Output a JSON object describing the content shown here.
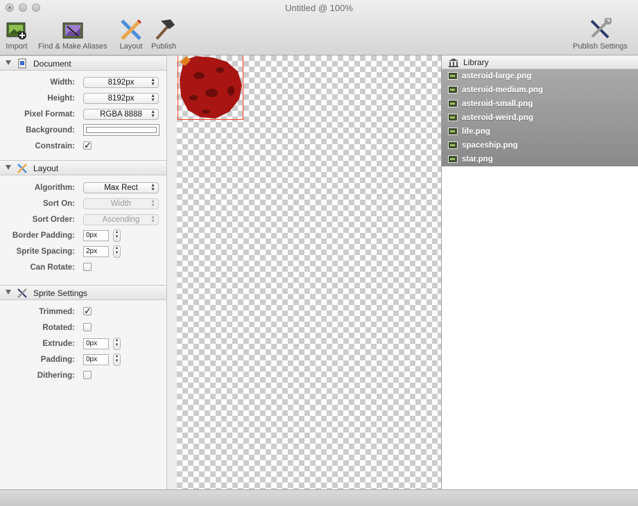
{
  "window": {
    "title": "Untitled @ 100%"
  },
  "toolbar": {
    "import": "Import",
    "find_aliases": "Find & Make Aliases",
    "layout": "Layout",
    "publish": "Publish",
    "publish_settings": "Publish Settings"
  },
  "document": {
    "title": "Document",
    "width_label": "Width:",
    "width_value": "8192px",
    "height_label": "Height:",
    "height_value": "8192px",
    "pixel_format_label": "Pixel Format:",
    "pixel_format_value": "RGBA 8888",
    "background_label": "Background:",
    "background_color": "#ffffff",
    "constrain_label": "Constrain:",
    "constrain_checked": true
  },
  "layout": {
    "title": "Layout",
    "algorithm_label": "Algorithm:",
    "algorithm_value": "Max Rect",
    "sort_on_label": "Sort On:",
    "sort_on_value": "Width",
    "sort_order_label": "Sort Order:",
    "sort_order_value": "Ascending",
    "border_padding_label": "Border Padding:",
    "border_padding_value": "0px",
    "sprite_spacing_label": "Sprite Spacing:",
    "sprite_spacing_value": "2px",
    "can_rotate_label": "Can Rotate:",
    "can_rotate_checked": false
  },
  "sprite_settings": {
    "title": "Sprite Settings",
    "trimmed_label": "Trimmed:",
    "trimmed_checked": true,
    "rotated_label": "Rotated:",
    "rotated_checked": false,
    "extrude_label": "Extrude:",
    "extrude_value": "0px",
    "padding_label": "Padding:",
    "padding_value": "0px",
    "dithering_label": "Dithering:",
    "dithering_checked": false
  },
  "library": {
    "title": "Library",
    "items": [
      "asteroid-large.png",
      "asteroid-medium.png",
      "asteroid-small.png",
      "asteroid-weird.png",
      "life.png",
      "spaceship.png",
      "star.png"
    ]
  },
  "colors": {
    "selection_border": "#ff3c1e",
    "asteroid": "#a91512",
    "library_selection": "#9a9a9a"
  }
}
